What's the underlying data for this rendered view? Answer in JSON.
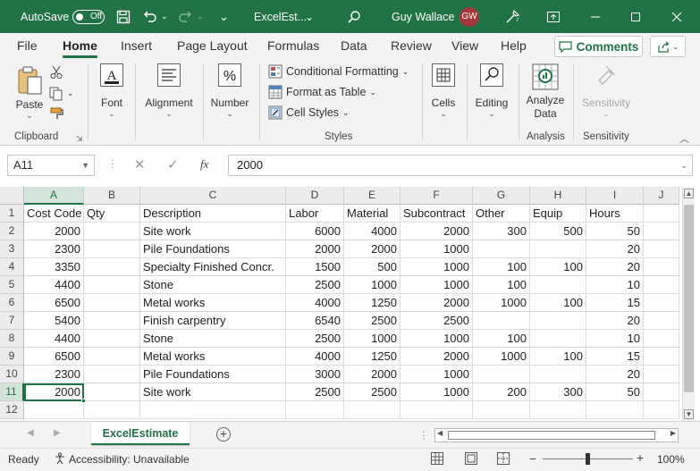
{
  "titlebar": {
    "autosave_label": "AutoSave",
    "autosave_state": "Off",
    "filename": "ExcelEst...",
    "user_name": "Guy Wallace",
    "user_initials": "GW",
    "brand_color": "#217346"
  },
  "menu": {
    "tabs": [
      "File",
      "Home",
      "Insert",
      "Page Layout",
      "Formulas",
      "Data",
      "Review",
      "View",
      "Help"
    ],
    "active_tab": "Home",
    "comments_label": "Comments"
  },
  "ribbon": {
    "paste_label": "Paste",
    "clipboard_label": "Clipboard",
    "font_label": "Font",
    "alignment_label": "Alignment",
    "number_label": "Number",
    "conditional_formatting": "Conditional Formatting",
    "format_as_table": "Format as Table",
    "cell_styles": "Cell Styles",
    "styles_label": "Styles",
    "cells_label": "Cells",
    "editing_label": "Editing",
    "analyze_data_line1": "Analyze",
    "analyze_data_line2": "Data",
    "analysis_label": "Analysis",
    "sensitivity_button": "Sensitivity",
    "sensitivity_label": "Sensitivity"
  },
  "formula_bar": {
    "name_box": "A11",
    "fx_symbol": "fx",
    "formula_value": "2000"
  },
  "grid": {
    "columns": [
      "A",
      "B",
      "C",
      "D",
      "E",
      "F",
      "G",
      "H",
      "I",
      "J"
    ],
    "selected_column": "A",
    "selected_row": 11,
    "rows": [
      {
        "num": "1",
        "cells": [
          "Cost Code",
          "Qty",
          "Description",
          "Labor",
          "Material",
          "Subcontract",
          "Other",
          "Equip",
          "Hours",
          ""
        ]
      },
      {
        "num": "2",
        "cells": [
          "2000",
          "",
          "Site work",
          "6000",
          "4000",
          "2000",
          "300",
          "500",
          "50",
          ""
        ]
      },
      {
        "num": "3",
        "cells": [
          "2300",
          "",
          "Pile Foundations",
          "2000",
          "2000",
          "1000",
          "",
          "",
          "20",
          ""
        ]
      },
      {
        "num": "4",
        "cells": [
          "3350",
          "",
          "Specialty Finished Concr.",
          "1500",
          "500",
          "1000",
          "100",
          "100",
          "20",
          ""
        ]
      },
      {
        "num": "5",
        "cells": [
          "4400",
          "",
          "Stone",
          "2500",
          "1000",
          "1000",
          "100",
          "",
          "10",
          ""
        ]
      },
      {
        "num": "6",
        "cells": [
          "6500",
          "",
          "Metal works",
          "4000",
          "1250",
          "2000",
          "1000",
          "100",
          "15",
          ""
        ]
      },
      {
        "num": "7",
        "cells": [
          "5400",
          "",
          "Finish carpentry",
          "6540",
          "2500",
          "2500",
          "",
          "",
          "20",
          ""
        ]
      },
      {
        "num": "8",
        "cells": [
          "4400",
          "",
          "Stone",
          "2500",
          "1000",
          "1000",
          "100",
          "",
          "10",
          ""
        ]
      },
      {
        "num": "9",
        "cells": [
          "6500",
          "",
          "Metal works",
          "4000",
          "1250",
          "2000",
          "1000",
          "100",
          "15",
          ""
        ]
      },
      {
        "num": "10",
        "cells": [
          "2300",
          "",
          "Pile Foundations",
          "3000",
          "2000",
          "1000",
          "",
          "",
          "20",
          ""
        ]
      },
      {
        "num": "11",
        "cells": [
          "2000",
          "",
          "Site work",
          "2500",
          "2500",
          "1000",
          "200",
          "300",
          "50",
          ""
        ]
      },
      {
        "num": "12",
        "cells": [
          "",
          "",
          "",
          "",
          "",
          "",
          "",
          "",
          "",
          ""
        ]
      }
    ]
  },
  "sheets": {
    "active": "ExcelEstimate"
  },
  "status": {
    "ready": "Ready",
    "accessibility": "Accessibility: Unavailable",
    "zoom": "100%"
  }
}
